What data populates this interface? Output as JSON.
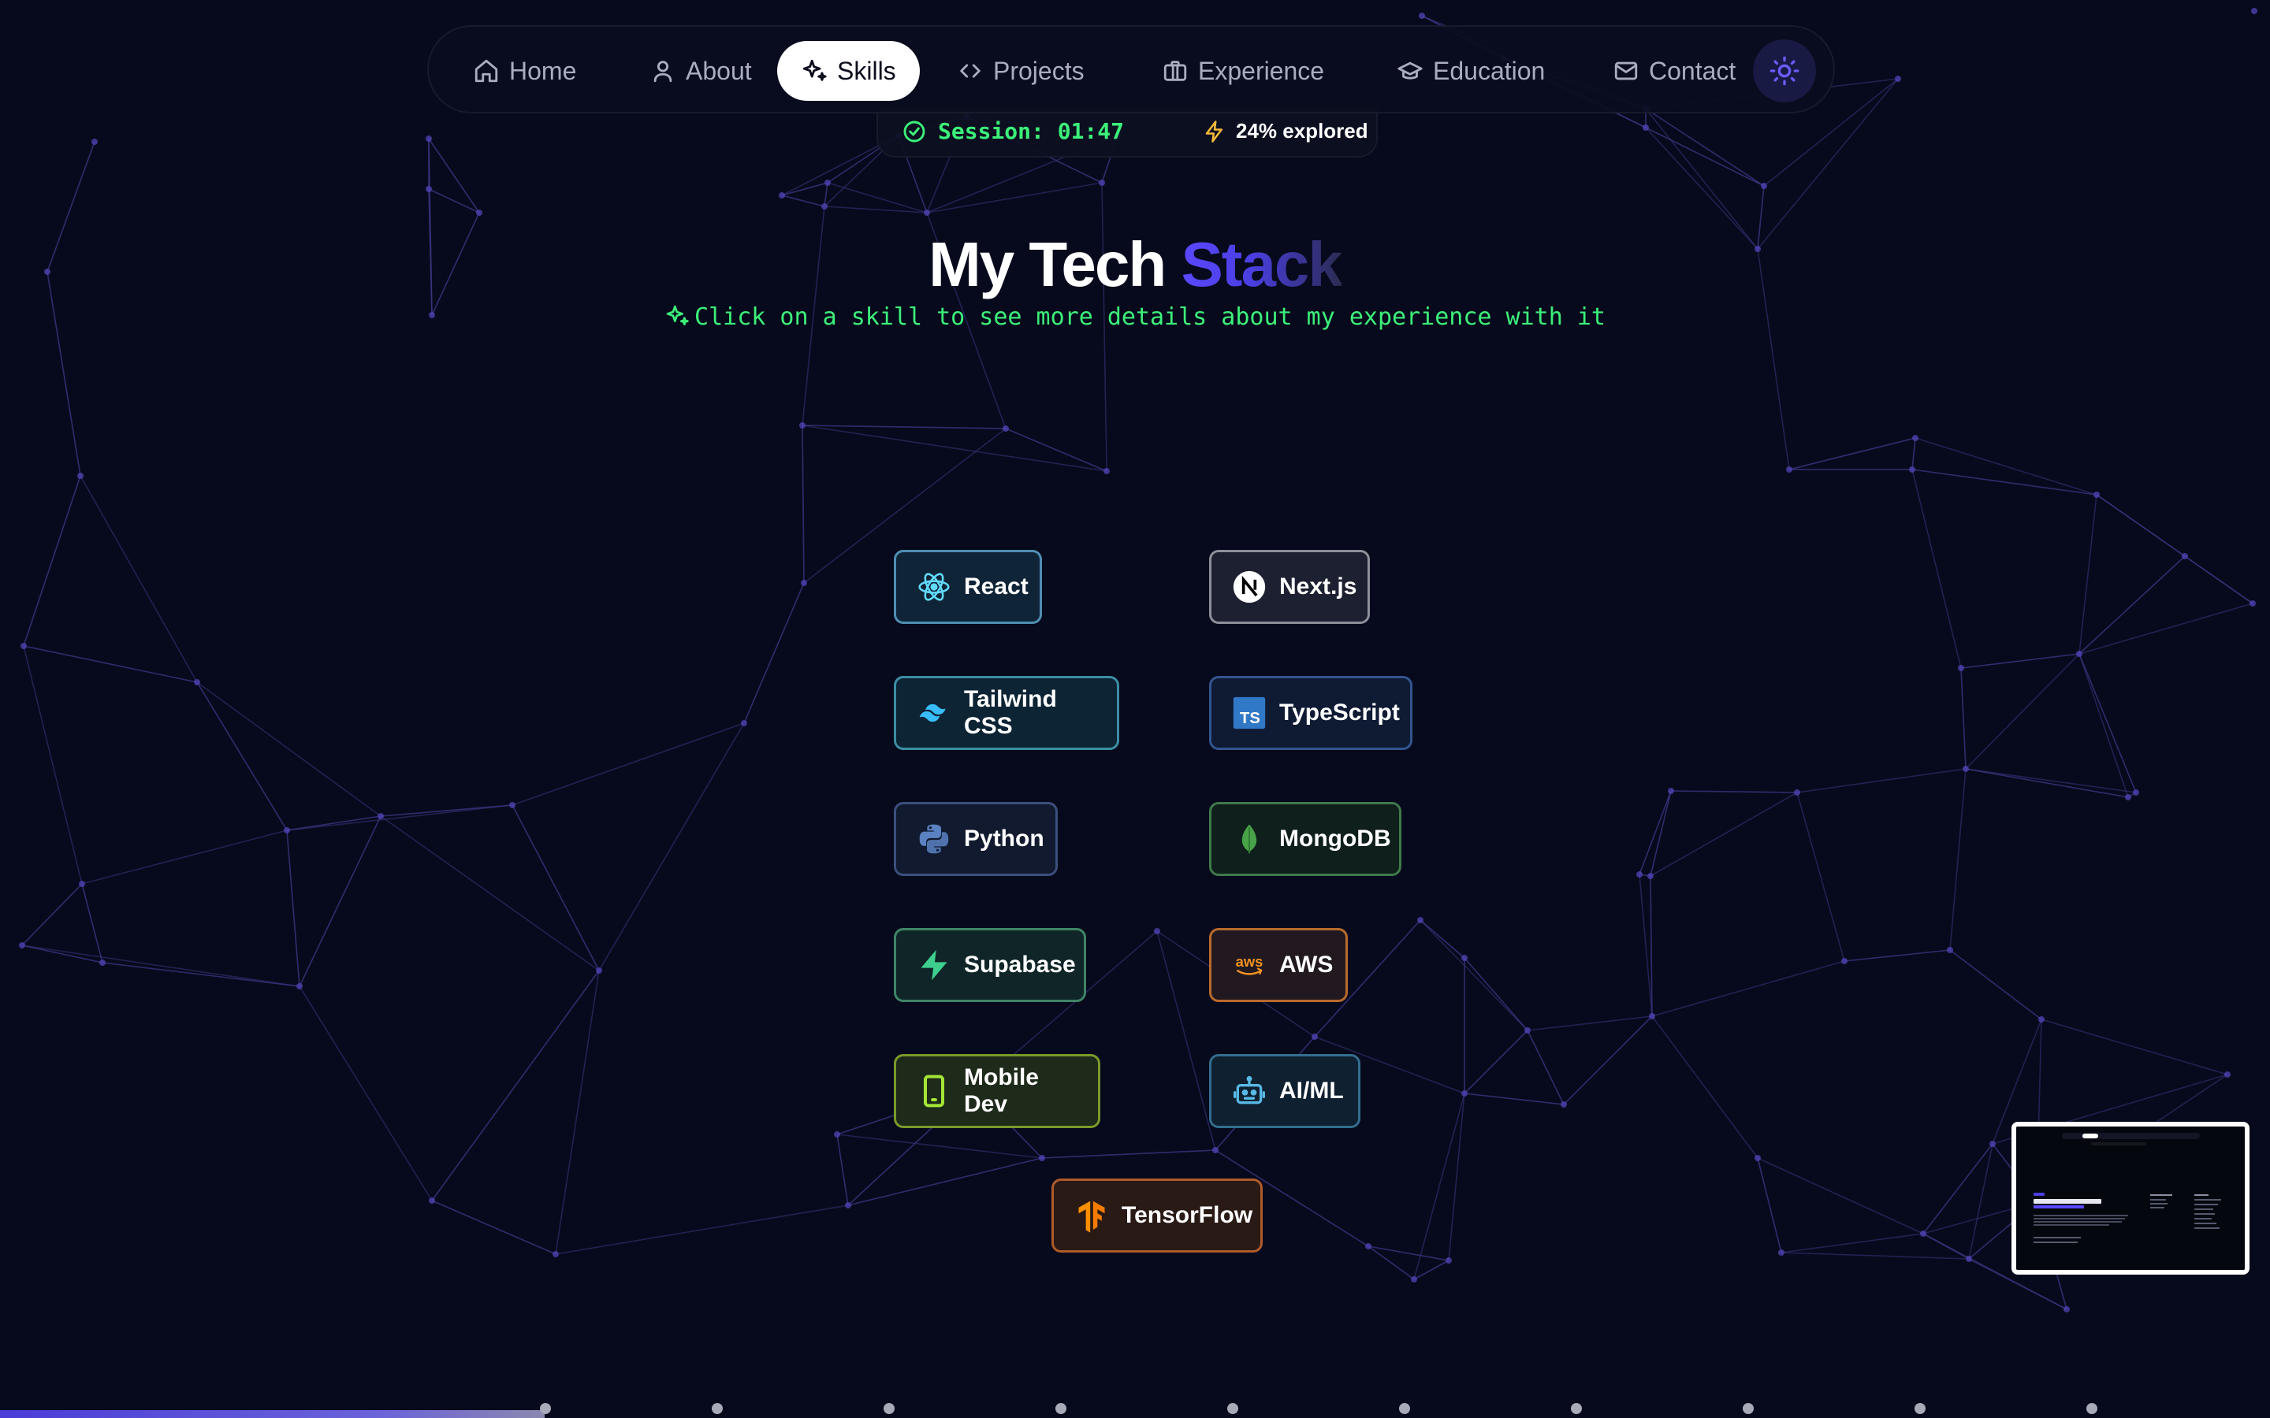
{
  "nav": {
    "items": [
      {
        "label": "Home",
        "icon": "home-icon"
      },
      {
        "label": "About",
        "icon": "user-icon"
      },
      {
        "label": "Skills",
        "icon": "sparkles-icon",
        "active": true
      },
      {
        "label": "Projects",
        "icon": "code-icon"
      },
      {
        "label": "Experience",
        "icon": "briefcase-icon"
      },
      {
        "label": "Education",
        "icon": "graduation-cap-icon"
      },
      {
        "label": "Contact",
        "icon": "mail-icon"
      }
    ],
    "theme_toggle_icon": "sun-icon"
  },
  "status": {
    "session": "Session: 01:47",
    "explored": "24% explored"
  },
  "heading": {
    "title_part1": "My Tech",
    "title_part2": "Stack",
    "subtitle": "Click on a skill to see more details about my experience with it"
  },
  "skills": [
    {
      "label": "React",
      "icon": "react-icon",
      "color": "#4f8fb3"
    },
    {
      "label": "Next.js",
      "icon": "nextjs-icon",
      "color": "#8d8f99"
    },
    {
      "label": "Tailwind CSS",
      "icon": "tailwind-icon",
      "color": "#3c8ea4"
    },
    {
      "label": "TypeScript",
      "icon": "typescript-icon",
      "color": "#32558f"
    },
    {
      "label": "Python",
      "icon": "python-icon",
      "color": "#3c4f7d"
    },
    {
      "label": "MongoDB",
      "icon": "mongodb-icon",
      "color": "#3f7a4a"
    },
    {
      "label": "Supabase",
      "icon": "supabase-icon",
      "color": "#3f8566"
    },
    {
      "label": "AWS",
      "icon": "aws-icon",
      "color": "#b86a2d"
    },
    {
      "label": "Mobile Dev",
      "icon": "smartphone-icon",
      "color": "#7a9a2a"
    },
    {
      "label": "AI/ML",
      "icon": "bot-icon",
      "color": "#336e8f"
    },
    {
      "label": "TensorFlow",
      "icon": "tensorflow-icon",
      "color": "#b05a2a"
    }
  ],
  "minimap": {
    "icon": "page-preview-thumbnail"
  },
  "progress": {
    "fraction": 0.24,
    "section_count": 10
  },
  "colors": {
    "background": "#070a1c",
    "accent": "#5a48ff",
    "terminal_green": "#3cf07a"
  }
}
